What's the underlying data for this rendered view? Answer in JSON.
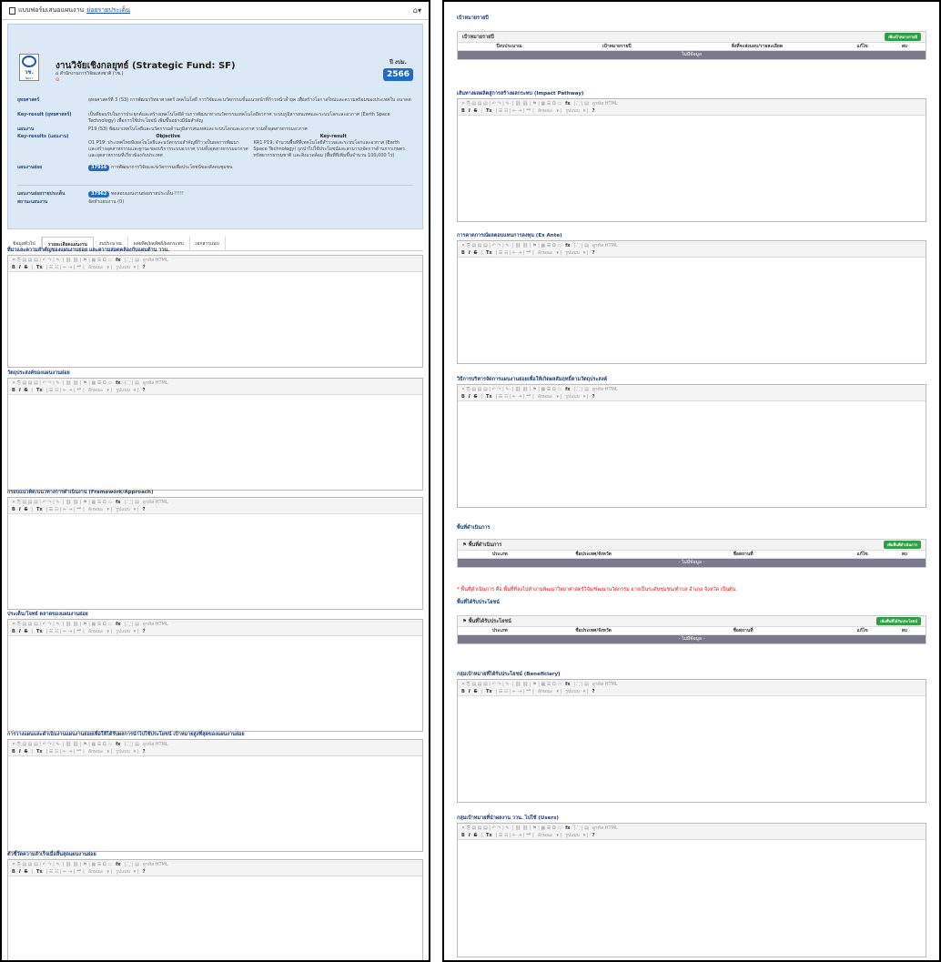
{
  "left": {
    "topbar": {
      "title_prefix": "แบบฟอร์มเสนอแผนงาน",
      "title_link": "ย่อยรายประเด็น",
      "home_icon": "home-icon"
    },
    "fund": {
      "title": "งานวิจัยเชิงกลยุทธ์ (Strategic Fund: SF)",
      "agency": "สำนักงานการวิจัยแห่งชาติ (วช.)",
      "logo_abbr": "วช.",
      "logo_sub": "NRCT"
    },
    "year": {
      "label": "ปี งปม.",
      "value": "2566"
    },
    "rows": {
      "strategy_k": "ยุทธศาสตร์",
      "strategy_v": "ยุทธศาสตร์ที่ 3 (S3) การพัฒนาวิทยาศาสตร์ เทคโนโลยี การวิจัยและนวัตกรรมขั้นแนวหน้าที่ก้าวหน้าล้ำยุค เพื่อสร้างโอกาสใหม่และความพร้อมของประเทศใน อนาคต",
      "kr_k": "Key-result (ยุทธศาสตร์)",
      "kr_v": "เป็นที่ยอมรับในการประยุกต์และสร้างเทคโนโลยีด้านการพัฒนาทางนวัตกรรมเทคโนโลยีอวกาศ ระบบภูมิสารสนเทศและระบบโลกและอวกาศ (Earth Space Technology) เพื่อการใช้ประโยชน์ เพิ่มขึ้นอย่างมีนัยสำคัญ",
      "plan_k": "แผนงาน",
      "plan_v": "P19 (S3) พัฒนาเทคโนโลยีและนวัตกรรมด้านภูมิสารสนเทศและระบบโลกและอวกาศ รวมทั้งอุตสาหกรรมอวกาศ",
      "krplan_k": "Key-results (แผนงาน)",
      "objective_h": "Objective",
      "objective_v": "O1 P19: ประเทศไทยมีเทคโนโลยีและนวัตกรรมสำคัญที่ก้าวเป็นผลการพัฒนา และสร้างอุตสาหกรรมและฐานะของบริการระบบอวกาศ รวมทั้งอุตสาหกรรมอวกาศ และอุตสาหกรรมที่เกี่ยวข้องกับประเทศ",
      "keyresult_h": "Key-result",
      "keyresult_v": "KR1 P19: จำนวนพื้นที่ที่เทคโนโลยีสำรวจและระบบโลกและอวกาศ (Earth Space Technology) ถูกนำไปใช้ประโยชน์และสามารถจัดการด้านการเกษตร ทรัพยากรธรรมชาติ และสิ่งแวดล้อม (พื้นที่ที่เพิ่มขึ้นจำนวน 100,000 ไร่)",
      "subplan_k": "แผนงานย่อย",
      "subplan_badge": "37916",
      "subplan_v": "การพัฒนาการวิจัยและนวัตกรรมเพื่อประโยชน์ของสังคมชุมชน",
      "issue_k": "แผนงานย่อยรายประเด็น",
      "issue_badge": "37962",
      "issue_v": "ทดสอบแผนงานย่อยรายประเด็น !!!!!",
      "status_k": "สถานะแผนงาน",
      "status_v": "จัดทำแผนงาน (0)"
    },
    "tabs": [
      "ข้อมูลทั่วไป",
      "รายละเอียดแผนงาน",
      "งบประมาณ",
      "ผลผลิต/ผลลัพธ์/ผลกระทบ",
      "เอกสารแนบ"
    ],
    "fields": [
      "ที่มาและความสำคัญของแผนงานย่อย และความสอดคล้องกับแผนด้าน ววน.",
      "วัตถุประสงค์ของแผนงานย่อย",
      "กรอบแนวคิด/แนวทางการดำเนินงาน (Framework/Approach)",
      "ประเด็น/โจทย์ ตลาดของแผนงานย่อย",
      "การวางแผนและดำเนินงานแผนงานย่อยเพื่อให้ได้รับผลการนำไปใช้ประโยชน์ เป้าหมายสูงที่สุดของแผนงานย่อย",
      "ตัวชี้วัดความสำเร็จเมื่อสิ้นสุดแผนงานย่อย"
    ]
  },
  "right": {
    "annual": {
      "title": "เป้าหมายรายปี",
      "box_title": "เป้าหมายรายปี",
      "add_button": "เพิ่มเป้าหมายรายปี",
      "columns": [
        "ปีงบประมาณ",
        "เป้าหมายรายปี",
        "สิ่งที่จะส่งมอบ/รายละเอียด",
        "แก้ไข",
        "ลบ"
      ],
      "nodata": "ไม่มีข้อมูล"
    },
    "editors": [
      "เส้นทางผลผลิตสู่การสร้างผลกระทบ (Impact Pathway)",
      "การคาดการณ์ผลตอบแทนการลงทุน (Ex Ante)",
      "วิธีการบริหารจัดการแผนงานย่อยเพื่อให้เกิดผลสัมฤทธิ์ตามวัตถุประสงค์"
    ],
    "operation": {
      "title": "พื้นที่ดำเนินการ",
      "box_title": "พื้นที่ดำเนินการ",
      "add_button": "เพิ่มพื้นที่ดำเนินการ",
      "columns": [
        "ประเภท",
        "ชื่อประเทศ/จังหวัด",
        "ชื่อสถานที่",
        "แก้ไข",
        "ลบ"
      ],
      "nodata": "- ไม่มีข้อมูล -"
    },
    "note": "* พื้นที่ดำเนินการ คือ พื้นที่ที่ลงไปทำงานพัฒนาวิทยาศาสตร์วิจัย/พัฒนานวัตกรรม อาจเป็นระดับชุมชน/ตำบล อำเภอ จังหวัด เป็นต้น",
    "benefit": {
      "title": "พื้นที่ได้รับประโยชน์",
      "box_title": "พื้นที่ได้รับประโยชน์",
      "add_button": "เพิ่มพื้นที่ได้รับประโยชน์",
      "columns": [
        "ประเภท",
        "ชื่อประเทศ/จังหวัด",
        "ชื่อสถานที่",
        "แก้ไข",
        "ลบ"
      ],
      "nodata": "- ไม่มีข้อมูล -"
    },
    "editors2": [
      "กลุ่มเป้าหมายที่ได้รับประโยชน์ (Beneficiary)",
      "กลุ่มเป้าหมายที่นำผลงาน ววน. ไปใช้ (Users)"
    ]
  },
  "toolbar": {
    "source": "ดูรหัส HTML",
    "style": "ลักษณะ",
    "format": "รูปแบบ",
    "help": "?"
  }
}
